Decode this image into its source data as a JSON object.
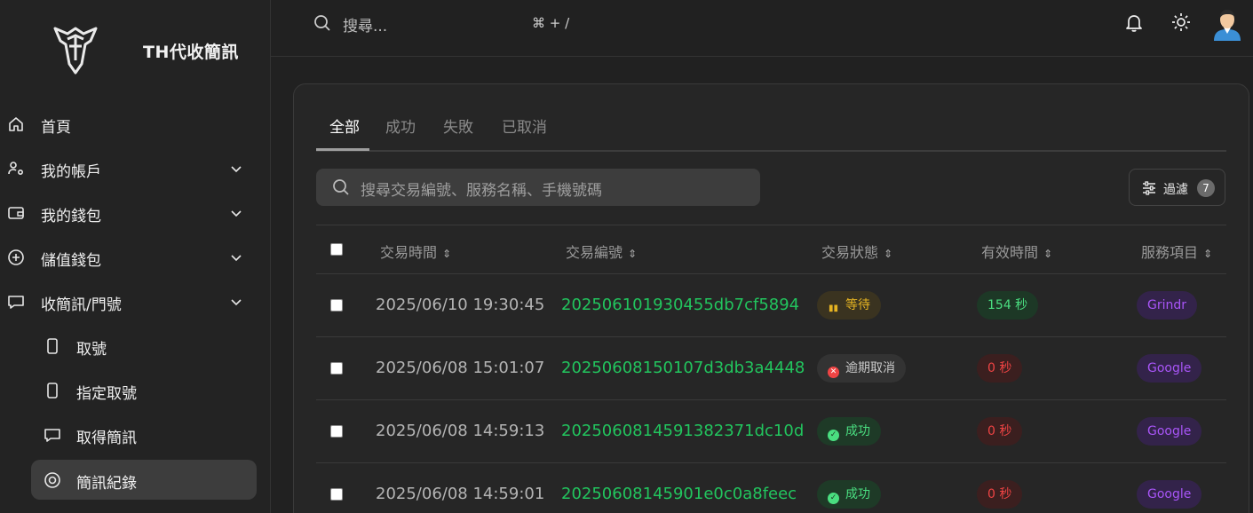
{
  "brand": {
    "name": "TH代收簡訊"
  },
  "sidebar": {
    "items": [
      {
        "label": "首頁",
        "icon": "home-icon"
      },
      {
        "label": "我的帳戶",
        "icon": "user-gear-icon"
      },
      {
        "label": "我的錢包",
        "icon": "wallet-icon"
      },
      {
        "label": "儲值錢包",
        "icon": "plus-circle-icon"
      },
      {
        "label": "收簡訊/門號",
        "icon": "message-icon"
      }
    ],
    "sub_items": [
      {
        "label": "取號",
        "icon": "phone-icon"
      },
      {
        "label": "指定取號",
        "icon": "phone-icon"
      },
      {
        "label": "取得簡訊",
        "icon": "message-icon"
      },
      {
        "label": "簡訊紀錄",
        "icon": "target-icon"
      }
    ]
  },
  "topbar": {
    "search_placeholder": "搜尋...",
    "shortcut": "⌘ + /"
  },
  "tabs": [
    "全部",
    "成功",
    "失敗",
    "已取消"
  ],
  "table_search": {
    "placeholder": "搜尋交易編號、服務名稱、手機號碼"
  },
  "filter": {
    "label": "過濾",
    "count": "7"
  },
  "table": {
    "columns": [
      "交易時間",
      "交易編號",
      "交易狀態",
      "有效時間",
      "服務項目"
    ],
    "rows": [
      {
        "time": "2025/06/10 19:30:45",
        "id": "202506101930455db7cf5894",
        "status": "等待",
        "status_type": "wait",
        "valid": "154 秒",
        "service": "Grindr"
      },
      {
        "time": "2025/06/08 15:01:07",
        "id": "20250608150107d3db3a4448",
        "status": "逾期取消",
        "status_type": "cancel",
        "valid": "0 秒",
        "service": "Google"
      },
      {
        "time": "2025/06/08 14:59:13",
        "id": "202506081459138237​1dc10d",
        "status": "成功",
        "status_type": "ok",
        "valid": "0 秒",
        "service": "Google"
      },
      {
        "time": "2025/06/08 14:59:01",
        "id": "20250608145901e0c0a8feec",
        "status": "成功",
        "status_type": "ok",
        "valid": "0 秒",
        "service": "Google"
      }
    ]
  },
  "colors": {
    "accent_green": "#22c55e",
    "purple": "#a855f7",
    "danger": "#ef4444",
    "warning": "#e6b422"
  }
}
